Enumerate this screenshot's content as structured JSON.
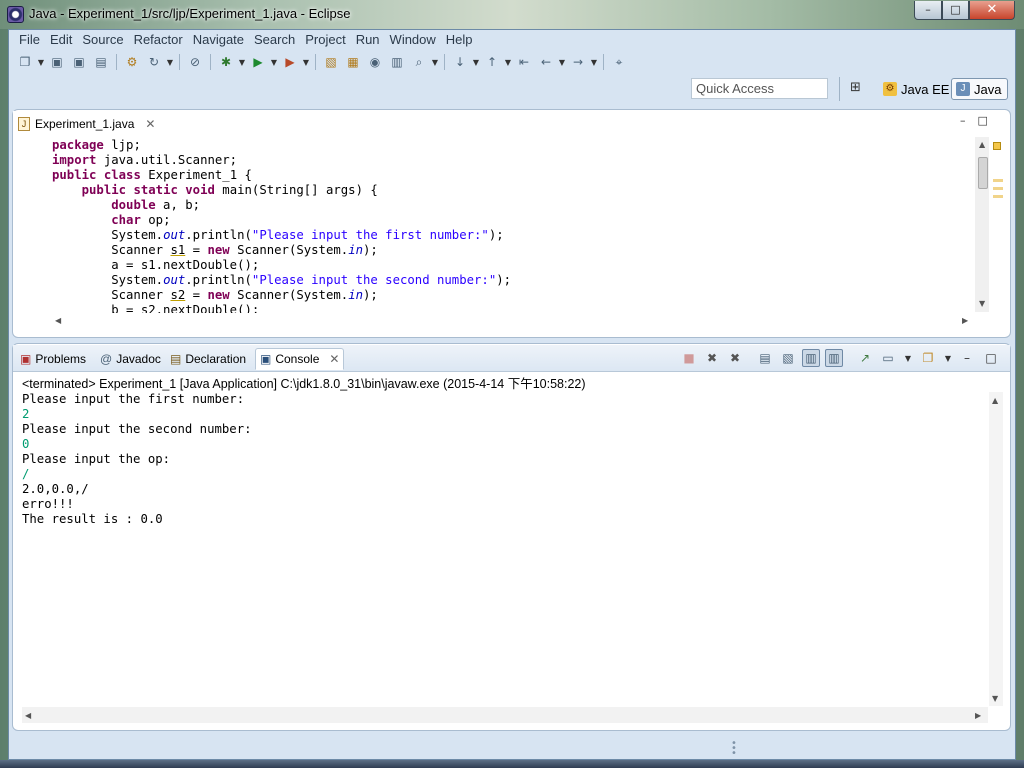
{
  "window": {
    "title": "Java - Experiment_1/src/ljp/Experiment_1.java - Eclipse",
    "min_glyph": "–",
    "max_glyph": "□",
    "close_glyph": "✕"
  },
  "menubar": {
    "items": [
      "File",
      "Edit",
      "Source",
      "Refactor",
      "Navigate",
      "Search",
      "Project",
      "Run",
      "Window",
      "Help"
    ]
  },
  "toolbar": {
    "icons": [
      "new-icon",
      "save-icon",
      "save-all-icon",
      "print-icon",
      "build-icon",
      "refresh-icon",
      "skip-breakpoints-icon",
      "debug-icon",
      "run-icon",
      "external-tools-icon",
      "new-java-project-icon",
      "new-package-icon",
      "new-class-icon",
      "open-type-icon",
      "search-icon",
      "next-annotation-icon",
      "prev-annotation-icon",
      "last-edit-icon",
      "back-icon",
      "forward-icon",
      "pin-editor-icon"
    ]
  },
  "perspective": {
    "quick_access_placeholder": "Quick Access",
    "java_ee_label": "Java EE",
    "java_label": "Java"
  },
  "editor": {
    "tab_label": "Experiment_1.java",
    "minimize_glyph": "–",
    "maximize_glyph": "□",
    "lines": [
      {
        "segments": [
          {
            "t": "package",
            "c": "kw"
          },
          {
            "t": " ljp;",
            "c": ""
          }
        ]
      },
      {
        "segments": [
          {
            "t": "import",
            "c": "kw"
          },
          {
            "t": " java.util.Scanner;",
            "c": ""
          }
        ]
      },
      {
        "segments": [
          {
            "t": "public",
            "c": "kw"
          },
          {
            "t": " ",
            "c": ""
          },
          {
            "t": "class",
            "c": "kw"
          },
          {
            "t": " Experiment_1 {",
            "c": ""
          }
        ]
      },
      {
        "segments": [
          {
            "t": "    ",
            "c": ""
          },
          {
            "t": "public",
            "c": "kw"
          },
          {
            "t": " ",
            "c": ""
          },
          {
            "t": "static",
            "c": "kw"
          },
          {
            "t": " ",
            "c": ""
          },
          {
            "t": "void",
            "c": "kw"
          },
          {
            "t": " main(String[] args) {",
            "c": ""
          }
        ]
      },
      {
        "segments": [
          {
            "t": "        ",
            "c": ""
          },
          {
            "t": "double",
            "c": "kw"
          },
          {
            "t": " a, b;",
            "c": ""
          }
        ]
      },
      {
        "segments": [
          {
            "t": "        ",
            "c": ""
          },
          {
            "t": "char",
            "c": "kw"
          },
          {
            "t": " op;",
            "c": ""
          }
        ]
      },
      {
        "segments": [
          {
            "t": "        System.",
            "c": ""
          },
          {
            "t": "out",
            "c": "fld"
          },
          {
            "t": ".println(",
            "c": ""
          },
          {
            "t": "\"Please input the first number:\"",
            "c": "str"
          },
          {
            "t": ");",
            "c": ""
          }
        ]
      },
      {
        "segments": [
          {
            "t": "        Scanner ",
            "c": ""
          },
          {
            "t": "s1",
            "c": "ul"
          },
          {
            "t": " = ",
            "c": ""
          },
          {
            "t": "new",
            "c": "kw"
          },
          {
            "t": " Scanner(System.",
            "c": ""
          },
          {
            "t": "in",
            "c": "fld"
          },
          {
            "t": ");",
            "c": ""
          }
        ]
      },
      {
        "segments": [
          {
            "t": "        a = s1.nextDouble();",
            "c": ""
          }
        ]
      },
      {
        "segments": [
          {
            "t": "        System.",
            "c": ""
          },
          {
            "t": "out",
            "c": "fld"
          },
          {
            "t": ".println(",
            "c": ""
          },
          {
            "t": "\"Please input the second number:\"",
            "c": "str"
          },
          {
            "t": ");",
            "c": ""
          }
        ]
      },
      {
        "segments": [
          {
            "t": "        Scanner ",
            "c": ""
          },
          {
            "t": "s2",
            "c": "ul"
          },
          {
            "t": " = ",
            "c": ""
          },
          {
            "t": "new",
            "c": "kw"
          },
          {
            "t": " Scanner(System.",
            "c": ""
          },
          {
            "t": "in",
            "c": "fld"
          },
          {
            "t": ");",
            "c": ""
          }
        ]
      },
      {
        "segments": [
          {
            "t": "        b = s2.nextDouble();",
            "c": ""
          }
        ]
      }
    ]
  },
  "bottom_panel": {
    "tabs": [
      {
        "label": "Problems",
        "icon": "problems-icon",
        "active": false
      },
      {
        "label": "Javadoc",
        "icon": "javadoc-icon",
        "active": false
      },
      {
        "label": "Declaration",
        "icon": "declaration-icon",
        "active": false
      },
      {
        "label": "Console",
        "icon": "console-icon",
        "active": true
      }
    ],
    "console": {
      "status": "<terminated> Experiment_1 [Java Application] C:\\jdk1.8.0_31\\bin\\javaw.exe (2015-4-14 下午10:58:22)",
      "lines": [
        {
          "text": "Please input the first number:",
          "input": false
        },
        {
          "text": "2",
          "input": true
        },
        {
          "text": "Please input the second number:",
          "input": false
        },
        {
          "text": "0",
          "input": true
        },
        {
          "text": "Please input the op:",
          "input": false
        },
        {
          "text": "/",
          "input": true
        },
        {
          "text": "2.0,0.0,/",
          "input": false
        },
        {
          "text": "erro!!!",
          "input": false
        },
        {
          "text": "The result is : 0.0",
          "input": false
        }
      ]
    }
  }
}
